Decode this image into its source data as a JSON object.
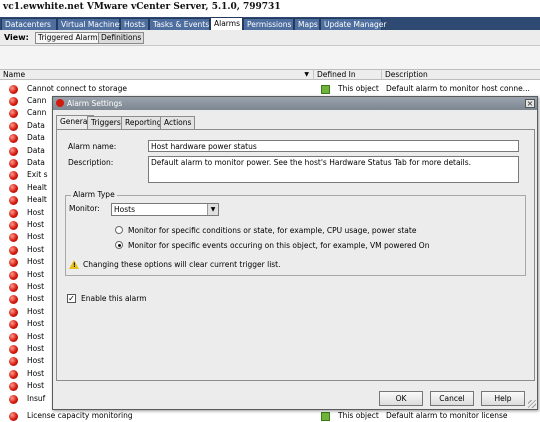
{
  "window": {
    "title": "vc1.ewwhite.net VMware vCenter Server, 5.1.0, 799731"
  },
  "top_tabs": [
    "Datacenters",
    "Virtual Machines",
    "Hosts",
    "Tasks & Events",
    "Alarms",
    "Permissions",
    "Maps",
    "Update Manager"
  ],
  "active_top_tab": "Alarms",
  "view_bar": {
    "label": "View:",
    "triggered": "Triggered Alarms",
    "definitions": "Definitions"
  },
  "table": {
    "headers": {
      "name": "Name",
      "defined_in": "Defined In",
      "description": "Description"
    },
    "first_row": {
      "name": "Cannot connect to storage",
      "defined_in": "This object",
      "description": "Default alarm to monitor host conne..."
    },
    "rows": [
      "Cann",
      "Cann",
      "Data",
      "Data",
      "Data",
      "Data",
      "Exit s",
      "Healt",
      "Healt",
      "Host",
      "Host",
      "Host",
      "Host",
      "Host",
      "Host",
      "Host",
      "Host",
      "Host",
      "Host",
      "Host",
      "Host",
      "Host",
      "Host",
      "Host",
      "Insuf"
    ],
    "last_row": {
      "name": "License capacity monitoring",
      "defined_in": "This object",
      "description": "Default alarm to monitor license"
    }
  },
  "dialog": {
    "title": "Alarm Settings",
    "close": "×",
    "tabs": [
      "General",
      "Triggers",
      "Reporting",
      "Actions"
    ],
    "active_tab": "General",
    "alarm_name_label": "Alarm name:",
    "alarm_name_value": "Host hardware power status",
    "description_label": "Description:",
    "description_value": "Default alarm to monitor power.  See the host's Hardware Status Tab for more details.",
    "alarm_type_legend": "Alarm Type",
    "monitor_label": "Monitor:",
    "monitor_value": "Hosts",
    "radio_conditions": "Monitor for specific conditions or state, for example, CPU usage, power state",
    "radio_events": "Monitor for specific events occuring on this object, for example, VM powered On",
    "radio_selected": "events",
    "warning_text": "Changing these options will clear current trigger list.",
    "enable_label": "Enable this alarm",
    "enable_checked": true,
    "ok": "OK",
    "cancel": "Cancel",
    "help": "Help"
  },
  "colors": {
    "tab_strip": "#2e4a73",
    "alarm_red": "#d31a0e",
    "defined_in_green": "#6fb33a",
    "dialog_bg": "#ececec"
  },
  "icons": {
    "alarm": "red-alarm-icon",
    "defined_in": "green-object-icon",
    "warning": "warning-icon"
  }
}
